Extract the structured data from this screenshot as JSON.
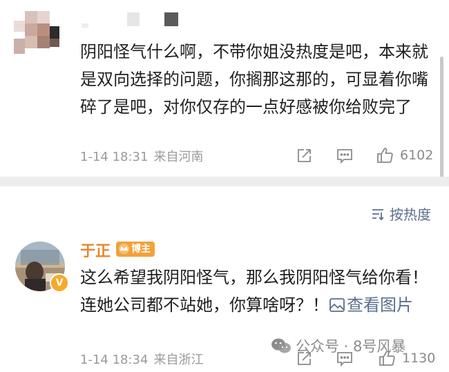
{
  "comments": [
    {
      "author": "",
      "text": "阴阳怪气什么啊，不带你姐没热度是吧，本来就是双向选择的问题，你搁那这那的，可显着你嘴碎了是吧，对你仅存的一点好感被你给败完了",
      "date": "1-14 18:31",
      "location": "来自河南",
      "likes": "6102",
      "icons": [
        "share-icon",
        "comment-icon",
        "like-icon"
      ]
    },
    {
      "author": "于正",
      "badge": "博主",
      "text": "这么希望我阴阳怪气，那么我阴阳怪气给你看！连她公司都不站她，你算啥呀？！",
      "view_image": "查看图片",
      "date": "1-14 18:34",
      "location": "来自浙江",
      "likes": "1130",
      "icons": [
        "share-icon",
        "comment-icon",
        "like-icon"
      ]
    }
  ],
  "sort": {
    "label": "按热度",
    "icon": "sort-icon"
  },
  "watermark": {
    "text": "公众号 · 8号风暴",
    "icon": "wechat-icon"
  },
  "colors": {
    "text": "#1f1f1f",
    "meta": "#9a9a9a",
    "author": "#e8852a",
    "badge": "#f2a23a",
    "link": "#5a6f8d",
    "divider": "#ededed"
  }
}
